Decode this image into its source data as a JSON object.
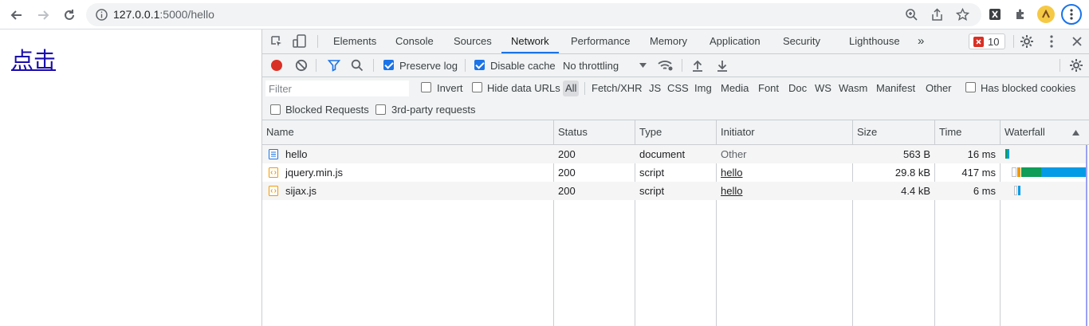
{
  "browser": {
    "url_host": "127.0.0.1",
    "url_rest": ":5000/hello"
  },
  "page": {
    "link_text": "点击"
  },
  "devtools": {
    "tabs": [
      "Elements",
      "Console",
      "Sources",
      "Network",
      "Performance",
      "Memory",
      "Application",
      "Security",
      "Lighthouse"
    ],
    "active_tab": "Network",
    "more_tabs": "»",
    "error_count": "10",
    "toolbar": {
      "preserve_log": "Preserve log",
      "preserve_log_checked": true,
      "disable_cache": "Disable cache",
      "disable_cache_checked": true,
      "throttling": "No throttling"
    },
    "filter": {
      "placeholder": "Filter",
      "invert": "Invert",
      "hide_data_urls": "Hide data URLs",
      "types": [
        "All",
        "Fetch/XHR",
        "JS",
        "CSS",
        "Img",
        "Media",
        "Font",
        "Doc",
        "WS",
        "Wasm",
        "Manifest",
        "Other"
      ],
      "active_type": "All",
      "has_blocked_cookies": "Has blocked cookies",
      "blocked_requests": "Blocked Requests",
      "third_party": "3rd-party requests"
    },
    "table": {
      "columns": [
        "Name",
        "Status",
        "Type",
        "Initiator",
        "Size",
        "Time",
        "Waterfall"
      ],
      "rows": [
        {
          "name": "hello",
          "status": "200",
          "type": "document",
          "initiator": "Other",
          "size": "563 B",
          "time": "16 ms"
        },
        {
          "name": "jquery.min.js",
          "status": "200",
          "type": "script",
          "initiator": "hello",
          "size": "29.8 kB",
          "time": "417 ms"
        },
        {
          "name": "sijax.js",
          "status": "200",
          "type": "script",
          "initiator": "hello",
          "size": "4.4 kB",
          "time": "6 ms"
        }
      ]
    },
    "colors": {
      "accent": "#1a73e8",
      "record": "#d93025",
      "wf_green": "#0f9d58",
      "wf_blue": "#039be5",
      "wf_orange": "#f29900"
    }
  }
}
